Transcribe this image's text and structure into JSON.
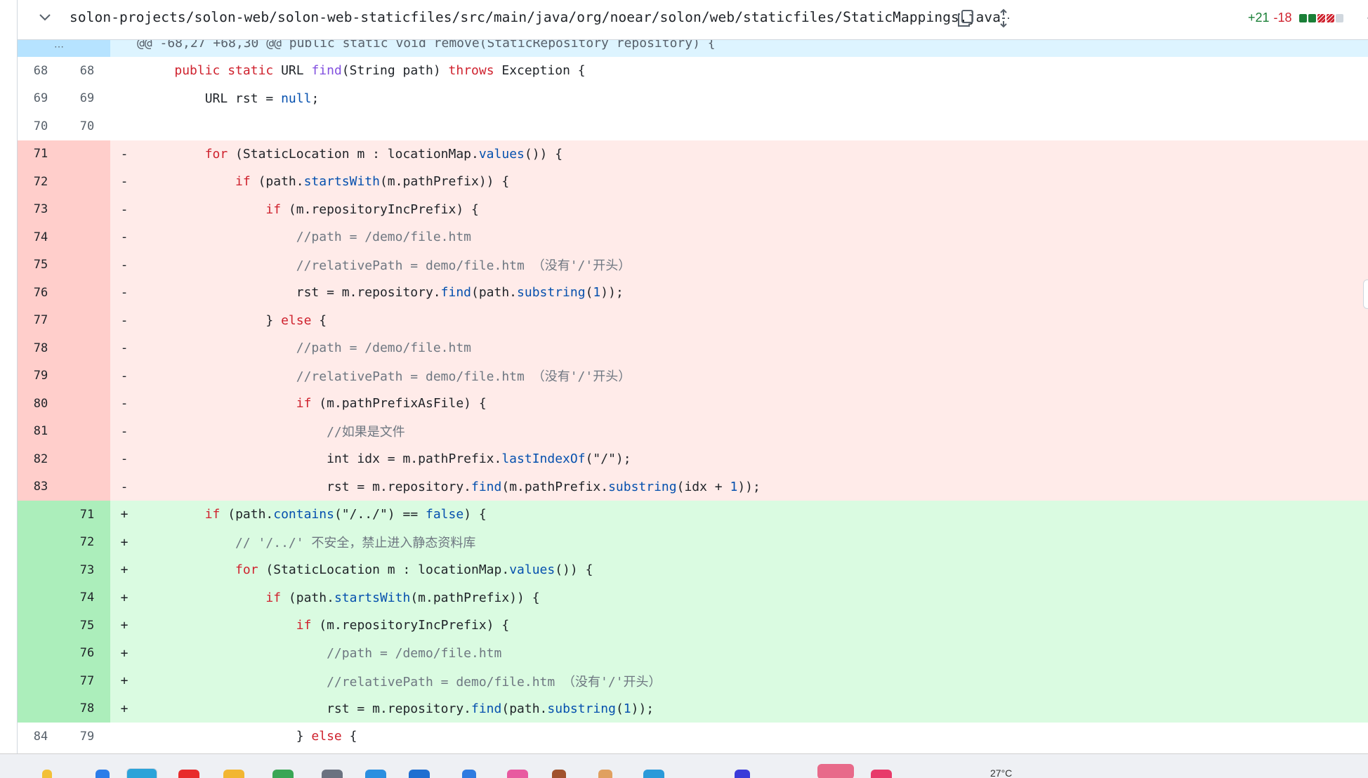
{
  "file_header": {
    "path": "solon-projects/solon-web/solon-web-staticfiles/src/main/java/org/noear/solon/web/staticfiles/StaticMappings.java",
    "additions": "+21",
    "deletions": "-18",
    "colors": {
      "add": "#1a7f37",
      "del": "#cf222e",
      "neutral": "#d0d7de"
    },
    "icons": [
      "chevron-down-icon",
      "copy-icon",
      "unfold-icon",
      "kebab-horizontal-icon"
    ]
  },
  "hunk_header": "@@ -68,27 +68,30 @@ public static void remove(StaticRepository repository) {",
  "rows": [
    {
      "type": "ctx",
      "old": "68",
      "new": "68",
      "mark": "",
      "tokens": [
        [
          "",
          "    "
        ],
        [
          "kw",
          "public static"
        ],
        [
          "",
          " URL "
        ],
        [
          "fn",
          "find"
        ],
        [
          "",
          "(String path) "
        ],
        [
          "kw",
          "throws"
        ],
        [
          "",
          " Exception {"
        ]
      ]
    },
    {
      "type": "ctx",
      "old": "69",
      "new": "69",
      "mark": "",
      "tokens": [
        [
          "",
          "        URL rst = "
        ],
        [
          "lit",
          "null"
        ],
        [
          "",
          ";"
        ]
      ]
    },
    {
      "type": "ctx",
      "old": "70",
      "new": "70",
      "mark": "",
      "tokens": [
        [
          "",
          ""
        ]
      ]
    },
    {
      "type": "rm",
      "old": "71",
      "new": "",
      "mark": "-",
      "tokens": [
        [
          "",
          "        "
        ],
        [
          "kw",
          "for"
        ],
        [
          "",
          " (StaticLocation m : locationMap."
        ],
        [
          "mt",
          "values"
        ],
        [
          "",
          "()) {"
        ]
      ]
    },
    {
      "type": "rm",
      "old": "72",
      "new": "",
      "mark": "-",
      "tokens": [
        [
          "",
          "            "
        ],
        [
          "kw",
          "if"
        ],
        [
          "",
          " (path."
        ],
        [
          "mt",
          "startsWith"
        ],
        [
          "",
          "(m.pathPrefix)) {"
        ]
      ]
    },
    {
      "type": "rm",
      "old": "73",
      "new": "",
      "mark": "-",
      "tokens": [
        [
          "",
          "                "
        ],
        [
          "kw",
          "if"
        ],
        [
          "",
          " (m.repositoryIncPrefix) {"
        ]
      ]
    },
    {
      "type": "rm",
      "old": "74",
      "new": "",
      "mark": "-",
      "tokens": [
        [
          "",
          "                    "
        ],
        [
          "cm",
          "//path = /demo/file.htm"
        ]
      ]
    },
    {
      "type": "rm",
      "old": "75",
      "new": "",
      "mark": "-",
      "tokens": [
        [
          "",
          "                    "
        ],
        [
          "cm",
          "//relativePath = demo/file.htm （没有'/'开头）"
        ]
      ]
    },
    {
      "type": "rm",
      "old": "76",
      "new": "",
      "mark": "-",
      "tokens": [
        [
          "",
          "                    rst = m.repository."
        ],
        [
          "mt",
          "find"
        ],
        [
          "",
          "(path."
        ],
        [
          "mt",
          "substring"
        ],
        [
          "",
          "("
        ],
        [
          "lit",
          "1"
        ],
        [
          "",
          "));"
        ]
      ]
    },
    {
      "type": "rm",
      "old": "77",
      "new": "",
      "mark": "-",
      "tokens": [
        [
          "",
          "                } "
        ],
        [
          "kw",
          "else"
        ],
        [
          "",
          " {"
        ]
      ]
    },
    {
      "type": "rm",
      "old": "78",
      "new": "",
      "mark": "-",
      "tokens": [
        [
          "",
          "                    "
        ],
        [
          "cm",
          "//path = /demo/file.htm"
        ]
      ]
    },
    {
      "type": "rm",
      "old": "79",
      "new": "",
      "mark": "-",
      "tokens": [
        [
          "",
          "                    "
        ],
        [
          "cm",
          "//relativePath = demo/file.htm （没有'/'开头）"
        ]
      ]
    },
    {
      "type": "rm",
      "old": "80",
      "new": "",
      "mark": "-",
      "tokens": [
        [
          "",
          "                    "
        ],
        [
          "kw",
          "if"
        ],
        [
          "",
          " (m.pathPrefixAsFile) {"
        ]
      ]
    },
    {
      "type": "rm",
      "old": "81",
      "new": "",
      "mark": "-",
      "tokens": [
        [
          "",
          "                        "
        ],
        [
          "cm",
          "//如果是文件"
        ]
      ]
    },
    {
      "type": "rm",
      "old": "82",
      "new": "",
      "mark": "-",
      "tokens": [
        [
          "",
          "                        int idx = m.pathPrefix."
        ],
        [
          "mt",
          "lastIndexOf"
        ],
        [
          "",
          "(\"/\");"
        ]
      ]
    },
    {
      "type": "rm",
      "old": "83",
      "new": "",
      "mark": "-",
      "tokens": [
        [
          "",
          "                        rst = m.repository."
        ],
        [
          "mt",
          "find"
        ],
        [
          "",
          "(m.pathPrefix."
        ],
        [
          "mt",
          "substring"
        ],
        [
          "",
          "(idx + "
        ],
        [
          "lit",
          "1"
        ],
        [
          "",
          "));"
        ]
      ]
    },
    {
      "type": "ad",
      "old": "",
      "new": "71",
      "mark": "+",
      "tokens": [
        [
          "",
          "        "
        ],
        [
          "kw",
          "if"
        ],
        [
          "",
          " (path."
        ],
        [
          "mt",
          "contains"
        ],
        [
          "",
          "(\"/../\") == "
        ],
        [
          "lit",
          "false"
        ],
        [
          "",
          ") {"
        ]
      ]
    },
    {
      "type": "ad",
      "old": "",
      "new": "72",
      "mark": "+",
      "tokens": [
        [
          "",
          "            "
        ],
        [
          "cm",
          "// '/../' 不安全，禁止进入静态资料库"
        ]
      ]
    },
    {
      "type": "ad",
      "old": "",
      "new": "73",
      "mark": "+",
      "tokens": [
        [
          "",
          "            "
        ],
        [
          "kw",
          "for"
        ],
        [
          "",
          " (StaticLocation m : locationMap."
        ],
        [
          "mt",
          "values"
        ],
        [
          "",
          "()) {"
        ]
      ]
    },
    {
      "type": "ad",
      "old": "",
      "new": "74",
      "mark": "+",
      "tokens": [
        [
          "",
          "                "
        ],
        [
          "kw",
          "if"
        ],
        [
          "",
          " (path."
        ],
        [
          "mt",
          "startsWith"
        ],
        [
          "",
          "(m.pathPrefix)) {"
        ]
      ]
    },
    {
      "type": "ad",
      "old": "",
      "new": "75",
      "mark": "+",
      "tokens": [
        [
          "",
          "                    "
        ],
        [
          "kw",
          "if"
        ],
        [
          "",
          " (m.repositoryIncPrefix) {"
        ]
      ]
    },
    {
      "type": "ad",
      "old": "",
      "new": "76",
      "mark": "+",
      "tokens": [
        [
          "",
          "                        "
        ],
        [
          "cm",
          "//path = /demo/file.htm"
        ]
      ]
    },
    {
      "type": "ad",
      "old": "",
      "new": "77",
      "mark": "+",
      "tokens": [
        [
          "",
          "                        "
        ],
        [
          "cm",
          "//relativePath = demo/file.htm （没有'/'开头）"
        ]
      ]
    },
    {
      "type": "ad",
      "old": "",
      "new": "78",
      "mark": "+",
      "tokens": [
        [
          "",
          "                        rst = m.repository."
        ],
        [
          "mt",
          "find"
        ],
        [
          "",
          "(path."
        ],
        [
          "mt",
          "substring"
        ],
        [
          "",
          "("
        ],
        [
          "lit",
          "1"
        ],
        [
          "",
          "));"
        ]
      ]
    },
    {
      "type": "ctx",
      "old": "84",
      "new": "79",
      "mark": "",
      "tokens": [
        [
          "",
          "                    } "
        ],
        [
          "kw",
          "else"
        ],
        [
          "",
          " {"
        ]
      ]
    }
  ],
  "taskbar": {
    "temperature": "27°C"
  }
}
